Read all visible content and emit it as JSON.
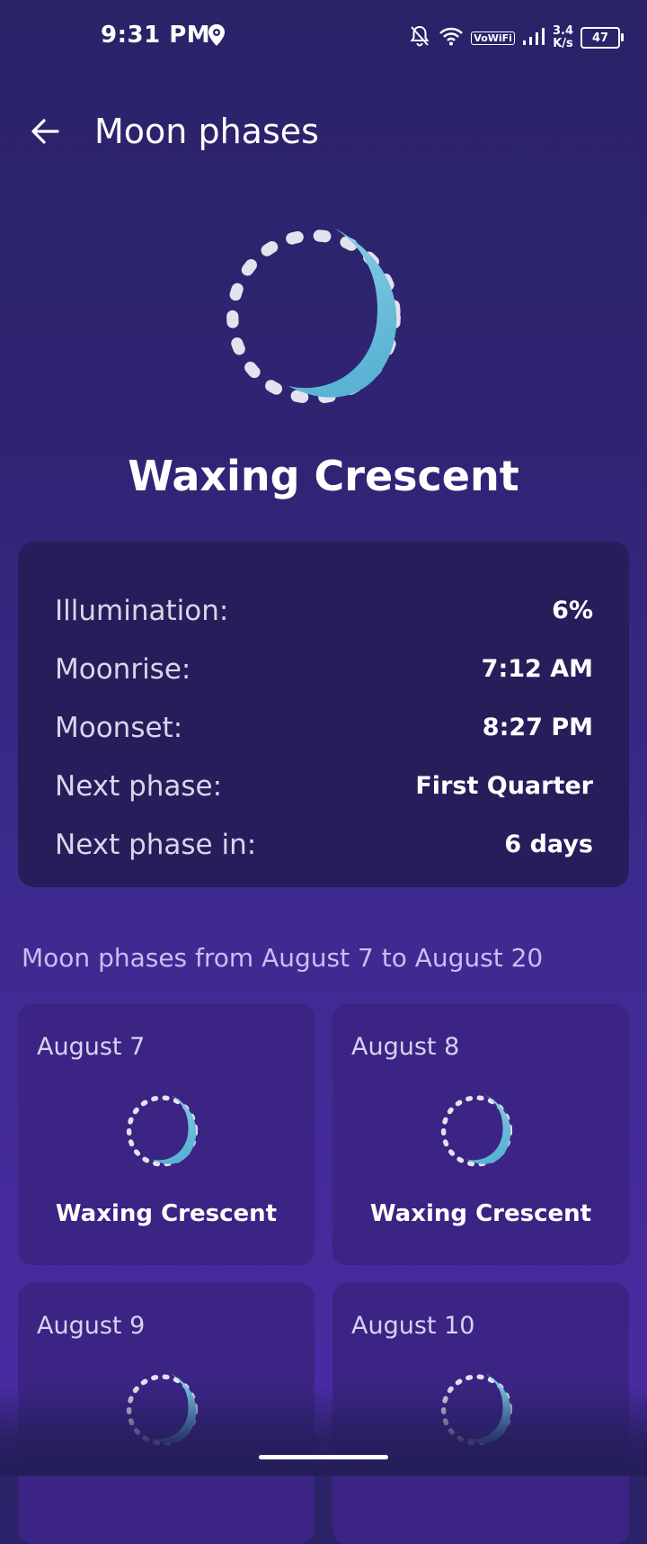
{
  "status_bar": {
    "time": "9:31 PM",
    "net_speed_value": "3.4",
    "net_speed_unit": "K/s",
    "wifi_calling": "VoWiFi",
    "battery": "47",
    "icons": [
      "location-icon",
      "bell-off-icon",
      "wifi-icon",
      "signal-icon",
      "battery-icon"
    ]
  },
  "app_bar": {
    "title": "Moon phases",
    "back_icon": "arrow-left-icon"
  },
  "current": {
    "phase": "Waxing Crescent"
  },
  "info": {
    "rows": [
      {
        "label": "Illumination:",
        "value": "6%"
      },
      {
        "label": "Moonrise:",
        "value": "7:12 AM"
      },
      {
        "label": "Moonset:",
        "value": "8:27 PM"
      },
      {
        "label": "Next phase:",
        "value": "First Quarter"
      },
      {
        "label": "Next phase in:",
        "value": "6 days"
      }
    ]
  },
  "range_title": "Moon phases from August 7 to August 20",
  "days": [
    {
      "date": "August 7",
      "phase": "Waxing Crescent"
    },
    {
      "date": "August 8",
      "phase": "Waxing Crescent"
    },
    {
      "date": "August 9",
      "phase": ""
    },
    {
      "date": "August 10",
      "phase": ""
    }
  ],
  "colors": {
    "background": "#2f2473",
    "card": "#281d5a",
    "day_card": "#3b2484",
    "moon": "#6fc0dc",
    "accent_text": "#c8bff0"
  }
}
